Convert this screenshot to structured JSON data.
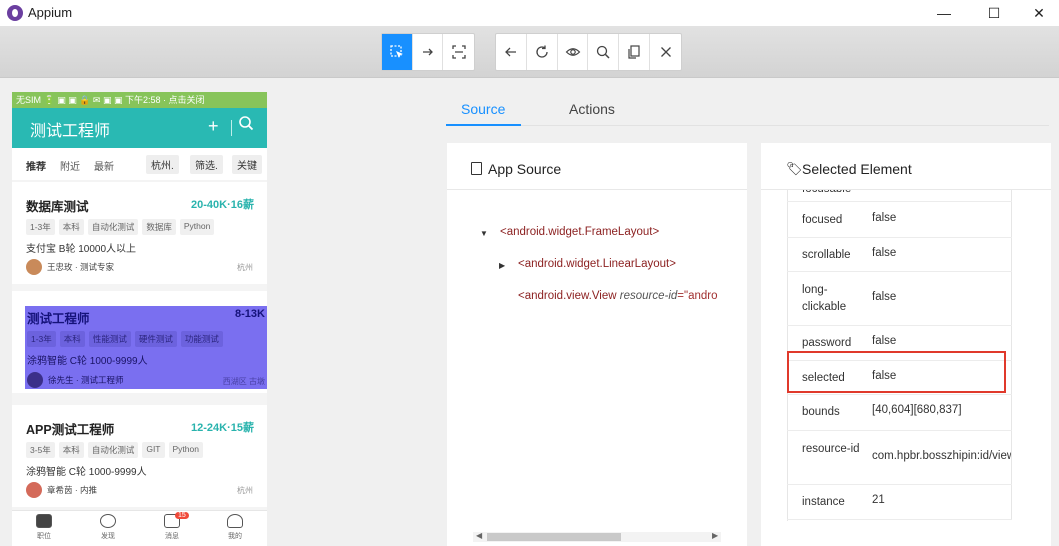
{
  "window": {
    "title": "Appium",
    "minimize": "—",
    "maximize": "☐",
    "close": "✕"
  },
  "toolbar": {
    "left_buttons": [
      {
        "name": "select-elements",
        "icon": "select-icon",
        "active": true
      },
      {
        "name": "swipe-by-coordinates",
        "icon": "arrow-right-icon",
        "active": false
      },
      {
        "name": "tap-by-coordinates",
        "icon": "crop-icon",
        "active": false
      }
    ],
    "right_buttons": [
      {
        "name": "back",
        "icon": "arrow-left-icon"
      },
      {
        "name": "refresh",
        "icon": "refresh-icon"
      },
      {
        "name": "search-recorder",
        "icon": "eye-icon"
      },
      {
        "name": "search-elements",
        "icon": "search-icon"
      },
      {
        "name": "copy-xml",
        "icon": "copy-icon"
      },
      {
        "name": "quit-session",
        "icon": "close-icon"
      }
    ]
  },
  "device": {
    "statusbar": "无SIM 🔋 ▣ ▣ 🔒 ✉ ▣ ▣ 下午2:58 · 点击关闭",
    "app_title": "测试工程师",
    "filters": {
      "recommend": "推荐",
      "nearby": "附近",
      "latest": "最新",
      "city": "杭州.",
      "filter": "筛选.",
      "keyword": "关键"
    },
    "jobs": [
      {
        "title": "数据库测试",
        "salary": "20-40K·16薪",
        "tags": [
          "1-3年",
          "本科",
          "自动化测试",
          "数据库",
          "Python"
        ],
        "company": "支付宝 B轮 10000人以上",
        "recruiter": "王忠玫 · 测试专家",
        "city": "杭州"
      },
      {
        "title": "测试工程师",
        "salary": "8-13K",
        "tags": [
          "1-3年",
          "本科",
          "性能测试",
          "硬件测试",
          "功能测试"
        ],
        "company": "涂鸦智能 C轮 1000-9999人",
        "recruiter": "徐先生 · 测试工程师",
        "city": "西湖区 古墩"
      },
      {
        "title": "APP测试工程师",
        "salary": "12-24K·15薪",
        "tags": [
          "3-5年",
          "本科",
          "自动化测试",
          "GIT",
          "Python"
        ],
        "company": "涂鸦智能 C轮 1000-9999人",
        "recruiter": "章希茵 · 内推",
        "city": "杭州"
      }
    ],
    "nav": {
      "jobs": "职位",
      "discover": "发现",
      "messages": "消息",
      "badge": "15",
      "me": "我的"
    }
  },
  "tabs": {
    "source": "Source",
    "actions": "Actions"
  },
  "app_source": {
    "title": "App Source",
    "nodes": {
      "n1": "<android.widget.FrameLayout>",
      "n2": "<android.widget.LinearLayout>",
      "n3_tag": "<android.view.View",
      "n3_attr": "resource-id",
      "n3_val": "=\"andro"
    }
  },
  "selected_element": {
    "title": "Selected Element",
    "rows": [
      {
        "key": "focusable",
        "value": "false"
      },
      {
        "key": "focused",
        "value": "false"
      },
      {
        "key": "scrollable",
        "value": "false"
      },
      {
        "key": "long-clickable",
        "value": "false"
      },
      {
        "key": "password",
        "value": "false"
      },
      {
        "key": "selected",
        "value": "false"
      },
      {
        "key": "bounds",
        "value": "[40,604][680,837]"
      },
      {
        "key": "resource-id",
        "value": "com.hpbr.bosszhipin:id/view_jo"
      },
      {
        "key": "instance",
        "value": "21"
      }
    ]
  },
  "colors": {
    "accent": "#1890ff",
    "highlight": "#e0392b",
    "selection": "#7a6ff0",
    "appbar": "#29b9b3"
  }
}
